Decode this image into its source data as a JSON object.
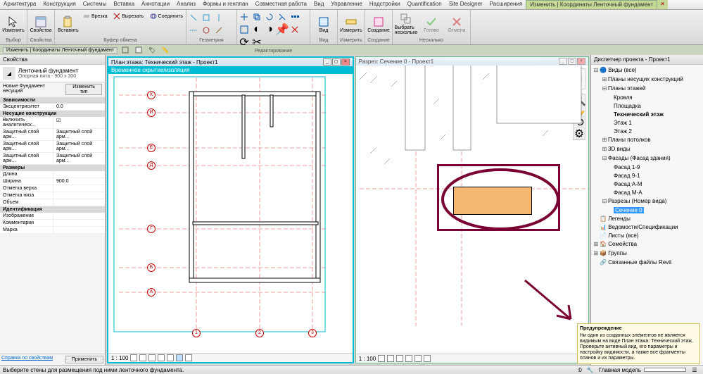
{
  "tabs": [
    "Архитектура",
    "Конструкция",
    "Системы",
    "Вставка",
    "Аннотации",
    "Анализ",
    "Формы и генплан",
    "Совместная работа",
    "Вид",
    "Управление",
    "Надстройки",
    "Quantification",
    "Site Designer",
    "Расширения",
    "Изменить | Координаты Ленточный фундамент"
  ],
  "active_tab_index": 14,
  "close_tab": "×",
  "ribbon": {
    "p1": {
      "title": "Выбор",
      "b1": "Изменить"
    },
    "p2": {
      "title": "Свойства",
      "b1": "Свойства"
    },
    "p3": {
      "title": "Буфер обмена",
      "b1": "Вставить",
      "s1": "Врезка",
      "s2": "Вырезать",
      "s3": "Соединить"
    },
    "p4": {
      "title": "Геометрия"
    },
    "p5": {
      "title": "Редактирование"
    },
    "p6": {
      "title": "Вид",
      "b1": "Вид"
    },
    "p7": {
      "title": "Измерить",
      "b1": "Измерить"
    },
    "p8": {
      "title": "Создание",
      "b1": "Создание"
    },
    "p9": {
      "title": "Несколько",
      "b1": "Выбрать\nнесколько",
      "b2": "Готово",
      "b3": "Отмена"
    }
  },
  "qat_hint": "Изменить | Координаты Ленточный фундамент",
  "properties": {
    "title": "Свойства",
    "type_family": "Ленточный фундамент",
    "type_name": "Опорная пята - 900 x 300",
    "filter": "Новые Фундамент несущий",
    "edit_type": "Изменить тип",
    "sections": {
      "deps": "Зависимости",
      "struct": "Несущие конструкции",
      "dims": "Размеры",
      "id": "Идентификация"
    },
    "rows": {
      "r1": {
        "k": "Эксцентриситет",
        "v": "0.0"
      },
      "r2": {
        "k": "Включить аналитическ...",
        "v": "☑"
      },
      "r3": {
        "k": "Защитный слой арм...",
        "v": "Защитный слой арм..."
      },
      "r4": {
        "k": "Защитный слой арм...",
        "v": "Защитный слой арм..."
      },
      "r5": {
        "k": "Защитный слой арм...",
        "v": "Защитный слой арм..."
      },
      "r6": {
        "k": "Длина",
        "v": ""
      },
      "r7": {
        "k": "Ширина",
        "v": "900.0"
      },
      "r8": {
        "k": "Отметка верха",
        "v": ""
      },
      "r9": {
        "k": "Отметка низа",
        "v": ""
      },
      "r10": {
        "k": "Объем",
        "v": ""
      },
      "r11": {
        "k": "Изображение",
        "v": ""
      },
      "r12": {
        "k": "Комментарии",
        "v": ""
      },
      "r13": {
        "k": "Марка",
        "v": ""
      }
    },
    "help": "Справка по свойствам",
    "apply": "Применить"
  },
  "views": {
    "left_title": "План этажа: Технический этаж - Проект1",
    "right_title": "Разрез: Сечение 0 - Проект1",
    "temp": "Временное скрытие/изоляция",
    "scale": "1 : 100",
    "grid_v": [
      "1",
      "2",
      "3"
    ],
    "grid_h": [
      "К",
      "И",
      "Е",
      "Д",
      "Г",
      "Б",
      "А"
    ]
  },
  "browser": {
    "title": "Диспетчер проекта - Проект1",
    "n0": "Виды (все)",
    "n1": "Планы несущих конструкций",
    "n2": "Планы этажей",
    "n2a": "Кровля",
    "n2b": "Площадка",
    "n2c": "Технический этаж",
    "n2d": "Этаж 1",
    "n2e": "Этаж 2",
    "n3": "Планы потолков",
    "n4": "3D виды",
    "n5": "Фасады (Фасад здания)",
    "n5a": "Фасад 1-9",
    "n5b": "Фасад 9-1",
    "n5c": "Фасад А-М",
    "n5d": "Фасад М-А",
    "n6": "Разрезы (Номер вида)",
    "n6a": "Сечение 0",
    "n7": "Легенды",
    "n8": "Ведомости/Спецификации",
    "n9": "Листы (все)",
    "n10": "Семейства",
    "n11": "Группы",
    "n12": "Связанные файлы Revit"
  },
  "status": {
    "left": "Выберите стены для размещения под ними ленточного фундамента.",
    "zero": ":0",
    "model": "Главная модель"
  },
  "warning": {
    "title": "Предупреждение",
    "text": "Ни один из созданных элементов не является видимым на виде План этажа: Технический этаж. Проверьте активный вид, его параметры и настройку видимости, а также все фрагменты планов и их параметры."
  }
}
